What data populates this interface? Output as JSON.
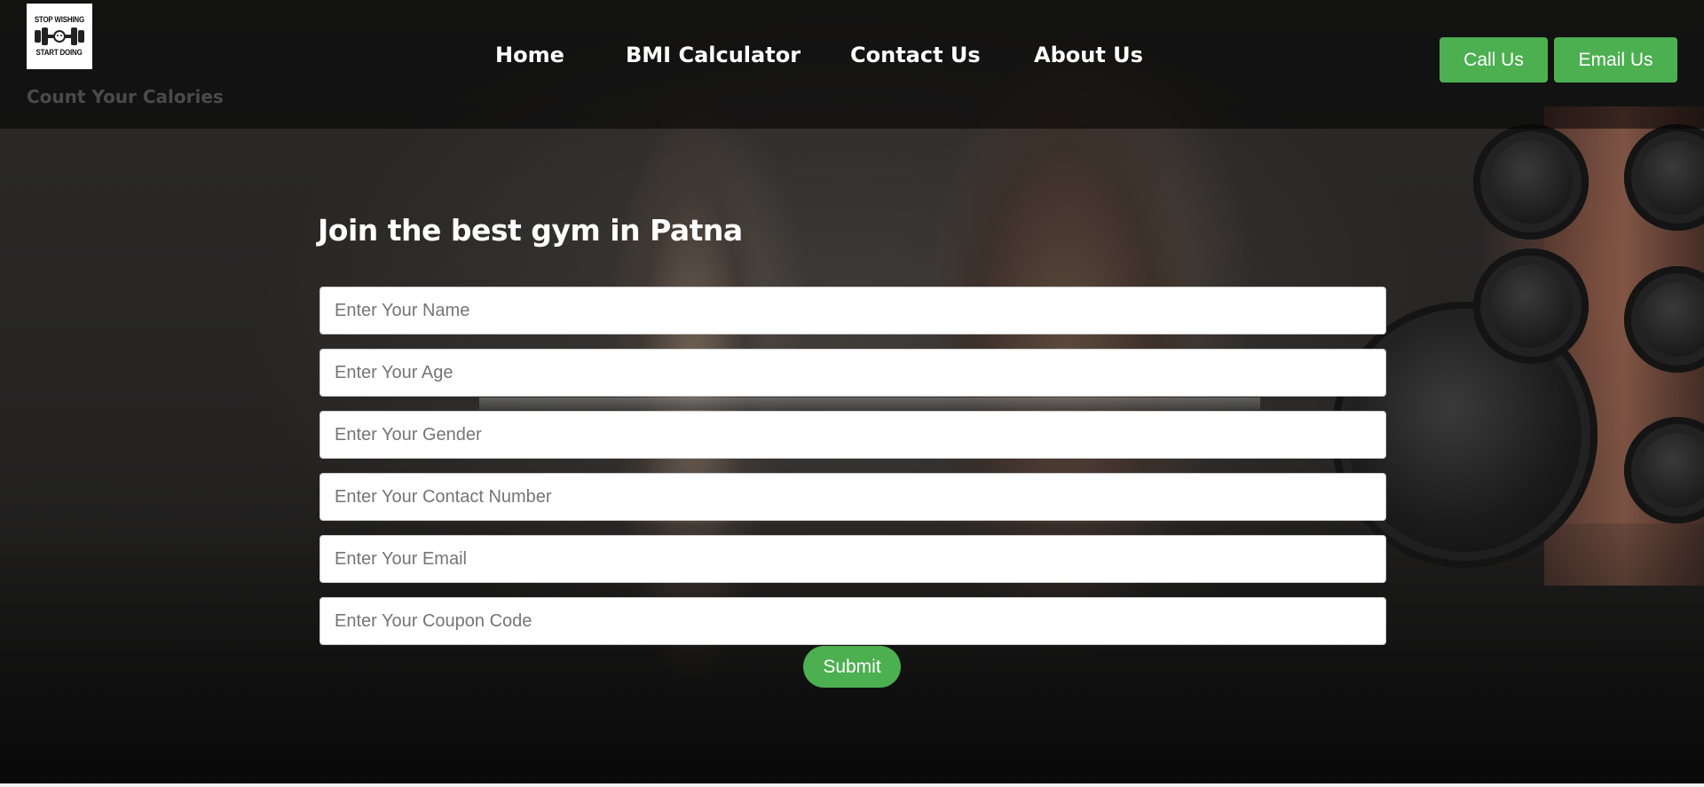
{
  "header": {
    "logo": {
      "line1": "STOP WISHING",
      "line2": "START DOING",
      "icon": "dumbbell-icon"
    },
    "tagline": "Count Your Calories",
    "nav": [
      {
        "label": "Home"
      },
      {
        "label": "BMI Calculator"
      },
      {
        "label": "Contact Us"
      },
      {
        "label": "About Us"
      }
    ],
    "actions": {
      "call_label": "Call Us",
      "email_label": "Email Us"
    }
  },
  "form": {
    "title": "Join the best gym in Patna",
    "fields": {
      "name": {
        "placeholder": "Enter Your Name",
        "value": ""
      },
      "age": {
        "placeholder": "Enter Your Age",
        "value": ""
      },
      "gender": {
        "placeholder": "Enter Your Gender",
        "value": ""
      },
      "contact": {
        "placeholder": "Enter Your Contact Number",
        "value": ""
      },
      "email": {
        "placeholder": "Enter Your Email",
        "value": ""
      },
      "coupon": {
        "placeholder": "Enter Your Coupon Code",
        "value": ""
      }
    },
    "submit_label": "Submit"
  },
  "colors": {
    "accent": "#4caf50",
    "header_overlay": "rgba(0,0,0,0.55)",
    "text": "#ffffff",
    "tagline": "#4a4a4a"
  }
}
